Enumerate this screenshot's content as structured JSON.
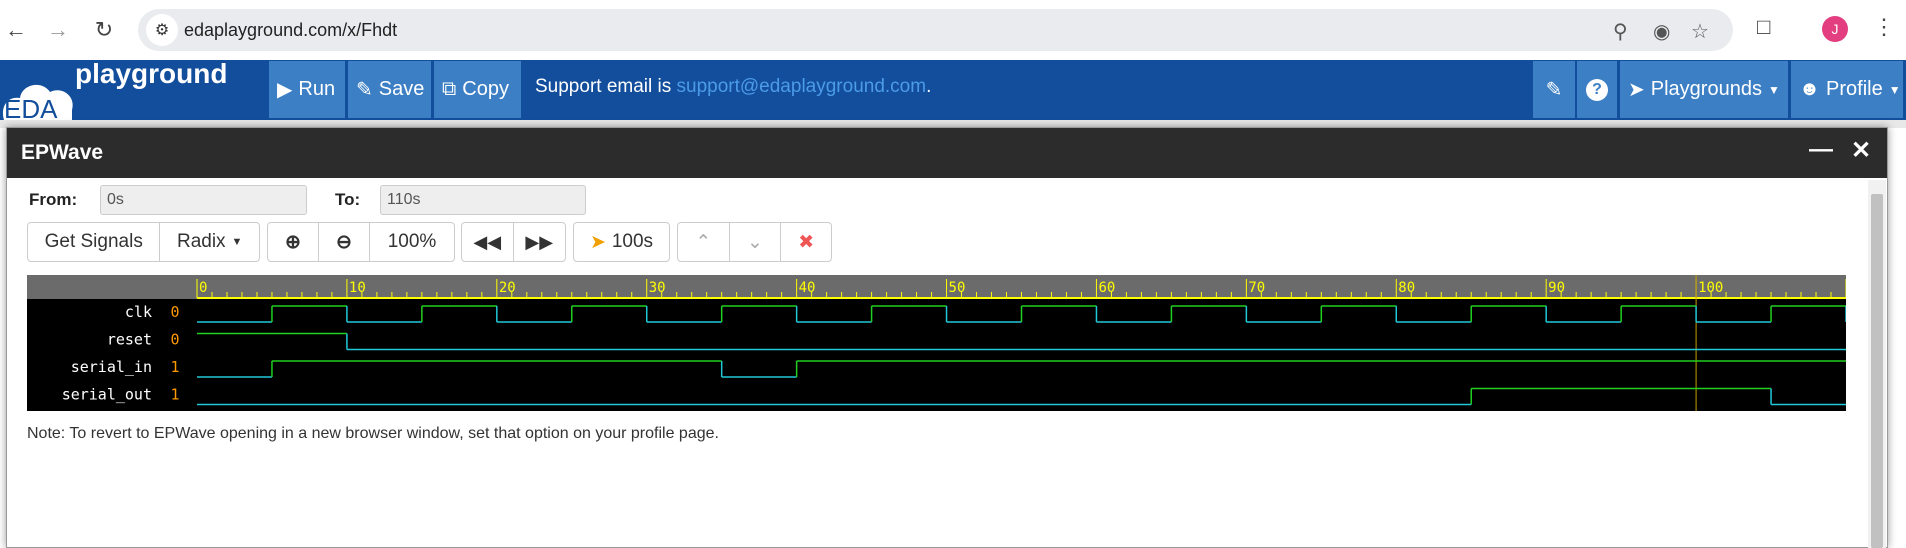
{
  "browser": {
    "url": "edaplayground.com/x/Fhdt",
    "avatar_letter": "J"
  },
  "app": {
    "logo_text": "playground",
    "logo_badge": "EDA",
    "run_label": "Run",
    "save_label": "Save",
    "copy_label": "Copy",
    "support_prefix": "Support email is ",
    "support_email": "support@edaplayground.com",
    "support_suffix": ".",
    "playgrounds_label": "Playgrounds",
    "profile_label": "Profile"
  },
  "epwave": {
    "title": "EPWave",
    "from_label": "From:",
    "from_value": "0s",
    "to_label": "To:",
    "to_value": "110s",
    "get_signals_label": "Get Signals",
    "radix_label": "Radix",
    "zoom_label": "100%",
    "cursor_label": "100s",
    "note": "Note: To revert to EPWave opening in a new browser window, set that option on your profile page."
  },
  "waveform": {
    "time_range": [
      0,
      110
    ],
    "major_tick_labels": [
      "0",
      "10",
      "20",
      "30",
      "40",
      "50",
      "60",
      "70",
      "80",
      "90",
      "100"
    ],
    "cursor_time": 100,
    "colors": {
      "high": "#20d020",
      "low": "#20c8d8",
      "ruler_text": "#ffff00",
      "cursor": "#c8a000"
    },
    "signals": [
      {
        "name": "clk",
        "value": "0",
        "transitions": [
          [
            0,
            0
          ],
          [
            5,
            1
          ],
          [
            10,
            0
          ],
          [
            15,
            1
          ],
          [
            20,
            0
          ],
          [
            25,
            1
          ],
          [
            30,
            0
          ],
          [
            35,
            1
          ],
          [
            40,
            0
          ],
          [
            45,
            1
          ],
          [
            50,
            0
          ],
          [
            55,
            1
          ],
          [
            60,
            0
          ],
          [
            65,
            1
          ],
          [
            70,
            0
          ],
          [
            75,
            1
          ],
          [
            80,
            0
          ],
          [
            85,
            1
          ],
          [
            90,
            0
          ],
          [
            95,
            1
          ],
          [
            100,
            0
          ],
          [
            105,
            1
          ],
          [
            110,
            0
          ]
        ]
      },
      {
        "name": "reset",
        "value": "0",
        "transitions": [
          [
            0,
            1
          ],
          [
            10,
            0
          ]
        ]
      },
      {
        "name": "serial_in",
        "value": "1",
        "transitions": [
          [
            0,
            0
          ],
          [
            5,
            1
          ],
          [
            35,
            0
          ],
          [
            40,
            1
          ]
        ]
      },
      {
        "name": "serial_out",
        "value": "1",
        "transitions": [
          [
            0,
            0
          ],
          [
            85,
            1
          ],
          [
            105,
            0
          ]
        ]
      }
    ]
  }
}
